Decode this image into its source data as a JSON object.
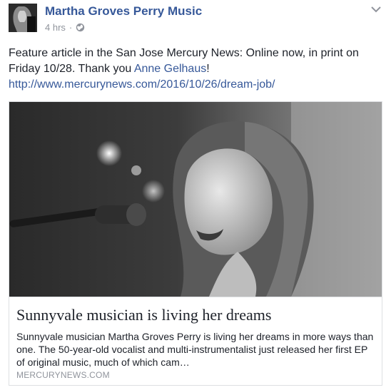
{
  "post": {
    "author": "Martha Groves Perry Music",
    "timestamp": "4 hrs",
    "separator": "·",
    "privacy_icon": "globe-icon",
    "menu_icon": "chevron-down-icon",
    "message_before": "Feature article in the San Jose Mercury News: Online now, in print on Friday 10/28. Thank you ",
    "mention": "Anne Gelhaus",
    "message_after": "!",
    "link": "http://www.mercurynews.com/2016/10/26/dream-job/"
  },
  "card": {
    "title": "Sunnyvale musician is living her dreams",
    "description": "Sunnyvale musician Martha Groves Perry is living her dreams in more ways than one. The 50-year-old vocalist and multi-instrumentalist just released her first EP of original music, much of which cam…",
    "domain": "MERCURYNEWS.COM"
  },
  "colors": {
    "link": "#365899",
    "text": "#1d2129",
    "muted": "#90949c",
    "border": "#dddfe2"
  }
}
